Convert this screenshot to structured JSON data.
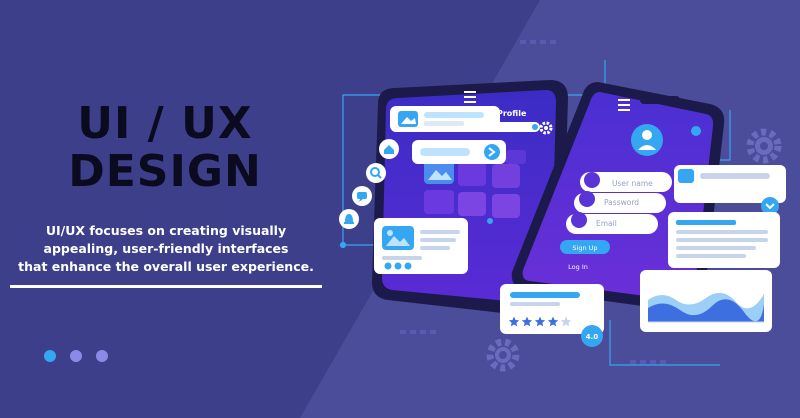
{
  "hero": {
    "title_line1": "UI / UX",
    "title_line2": "DESIGN",
    "description_line1": "UI/UX focuses on creating visually",
    "description_line2": "appealing, user-friendly interfaces",
    "description_line3": "that enhance the overall user experience."
  },
  "phone_left": {
    "header_title": "Profile"
  },
  "phone_right": {
    "field_username": "User name",
    "field_password": "Password",
    "field_email": "Email",
    "signup_label": "Sign Up",
    "login_label": "Log In"
  },
  "rating_card": {
    "score": "4.0",
    "stars_filled": 4,
    "stars_total": 5
  },
  "colors": {
    "background": "#3e3f8a",
    "accent_blue": "#35a6f2",
    "phone_body": "#1c1a4a",
    "screen_purple": "#4a2ad0"
  },
  "carousel": {
    "active_index": 1,
    "count": 3
  }
}
